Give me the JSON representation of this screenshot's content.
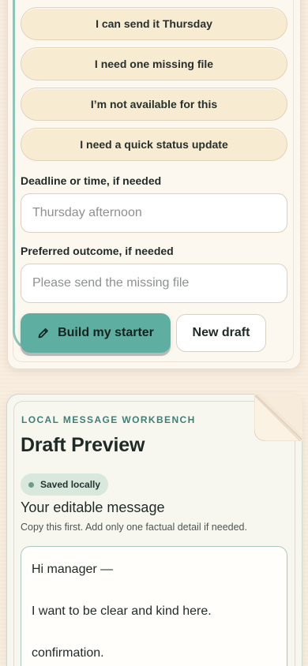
{
  "composer": {
    "quick_replies": [
      {
        "label": "I can send it Thursday"
      },
      {
        "label": "I need one missing file"
      },
      {
        "label": "I’m not available for this"
      },
      {
        "label": "I need a quick status update"
      }
    ],
    "deadline": {
      "label": "Deadline or time, if needed",
      "value": "",
      "placeholder": "Thursday afternoon"
    },
    "outcome": {
      "label": "Preferred outcome, if needed",
      "value": "",
      "placeholder": "Please send the missing file"
    },
    "build_button": {
      "label": "Build my starter",
      "icon": "pencil-icon"
    },
    "new_draft_button": {
      "label": "New draft"
    }
  },
  "preview": {
    "eyebrow": "LOCAL MESSAGE WORKBENCH",
    "title": "Draft Preview",
    "status_badge": "Saved locally",
    "message_heading": "Your editable message",
    "message_help": "Copy this first. Add only one factual detail if needed.",
    "message_lines": [
      "Hi manager —",
      "I want to be clear and kind here.",
      "confirmation."
    ]
  },
  "colors": {
    "page_background": "#f7ebdc",
    "card_background": "#fcf8f0",
    "chip_background": "#f7ebd2",
    "accent_teal": "#5faea2",
    "eyebrow_teal": "#3f7f76",
    "badge_background": "#d9e8dc"
  }
}
